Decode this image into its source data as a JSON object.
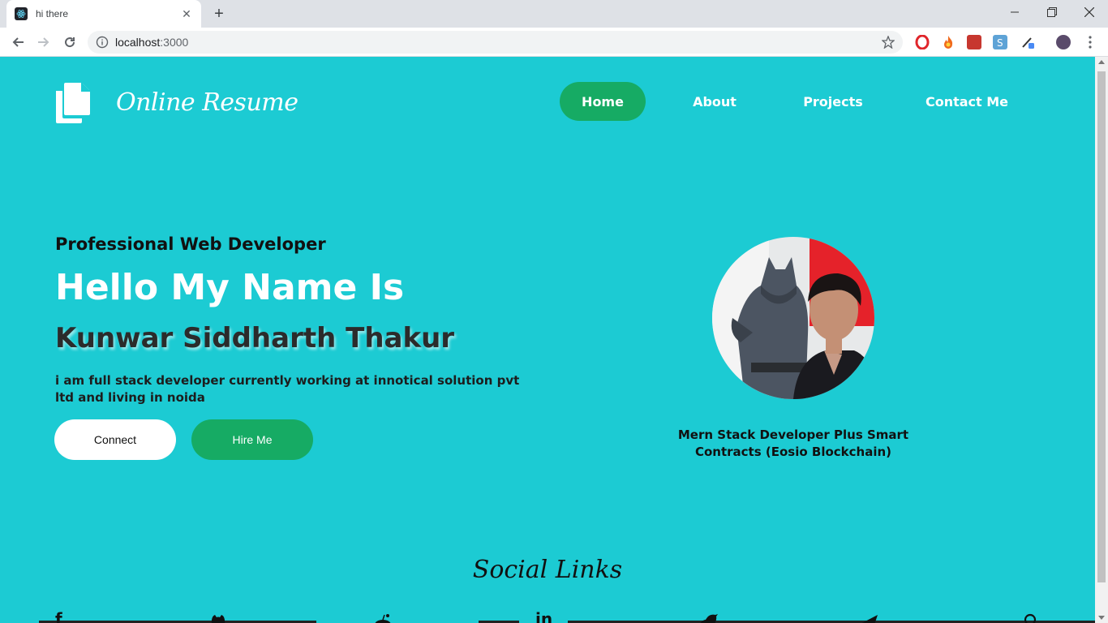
{
  "browser": {
    "tab_title": "hi there",
    "url_host": "localhost",
    "url_port": ":3000"
  },
  "header": {
    "brand": "Online Resume",
    "nav": [
      {
        "label": "Home",
        "active": true
      },
      {
        "label": "About",
        "active": false
      },
      {
        "label": "Projects",
        "active": false
      },
      {
        "label": "Contact Me",
        "active": false
      }
    ]
  },
  "hero": {
    "subtitle": "Professional Web Developer",
    "greeting": "Hello My Name Is",
    "name": "Kunwar Siddharth Thakur",
    "description": "i am full stack developer currently working at innotical solution pvt ltd and living in noida",
    "connect_label": "Connect",
    "hire_label": "Hire Me"
  },
  "profile": {
    "caption": "Mern Stack Developer Plus Smart Contracts (Eosio Blockchain)"
  },
  "social": {
    "title": "Social Links",
    "icons": [
      "facebook-icon",
      "github-icon",
      "reddit-icon",
      "linkedin-icon",
      "twitter-icon",
      "telegram-icon",
      "location-icon"
    ]
  },
  "colors": {
    "background": "#1ccbd3",
    "accent": "#16ab64",
    "white": "#ffffff"
  }
}
